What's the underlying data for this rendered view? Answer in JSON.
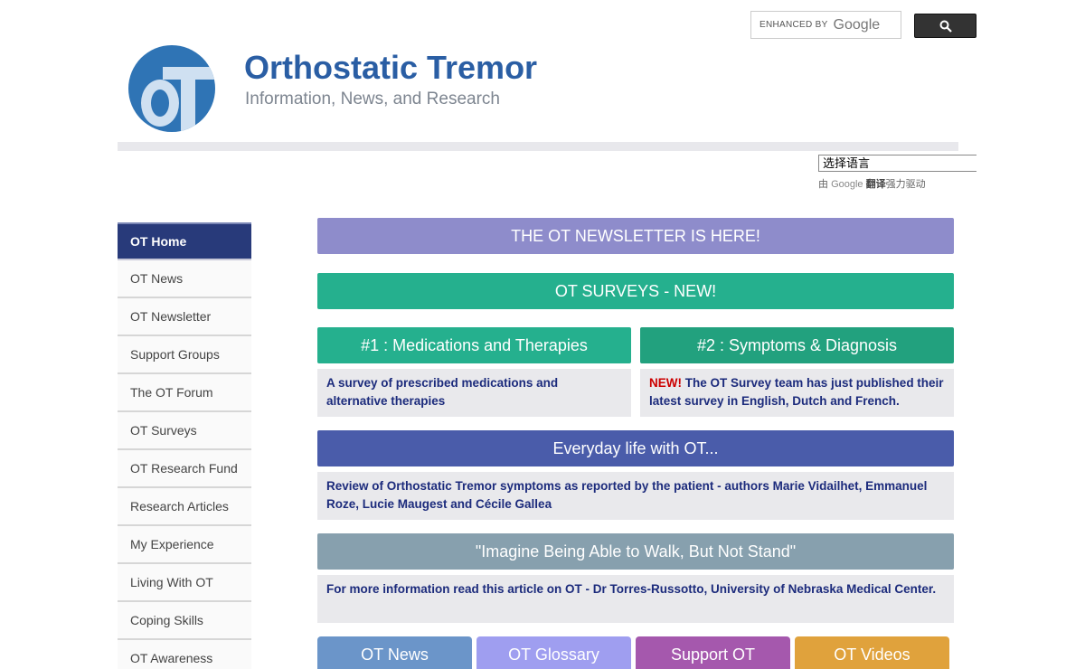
{
  "search": {
    "enhanced_label": "ENHANCED BY",
    "google_label": "Google"
  },
  "header": {
    "logo_text": "OT",
    "title": "Orthostatic Tremor",
    "subtitle": "Information, News, and Research"
  },
  "translate": {
    "select_value": "选择语言",
    "powered_prefix": "由",
    "google": "Google",
    "fanyi": "翻译",
    "powered_suffix": "强力驱动"
  },
  "sidebar": {
    "items": [
      {
        "label": "OT Home",
        "active": true
      },
      {
        "label": "OT News"
      },
      {
        "label": "OT Newsletter"
      },
      {
        "label": "Support Groups"
      },
      {
        "label": "The OT Forum"
      },
      {
        "label": "OT Surveys"
      },
      {
        "label": "OT Research Fund"
      },
      {
        "label": "Research Articles"
      },
      {
        "label": "My Experience"
      },
      {
        "label": "Living With OT"
      },
      {
        "label": "Coping Skills"
      },
      {
        "label": "OT Awareness"
      }
    ]
  },
  "main": {
    "newsletter_banner": "THE OT NEWSLETTER IS HERE!",
    "surveys_banner": "OT SURVEYS - NEW!",
    "survey1": {
      "title": "#1 : Medications and Therapies",
      "text": "A survey of prescribed medications and alternative therapies"
    },
    "survey2": {
      "title": "#2 : Symptoms & Diagnosis",
      "new_tag": "NEW!",
      "text": " The OT Survey team has just published their latest survey in English, Dutch and French."
    },
    "everyday": {
      "title": "Everyday life with OT...",
      "text": "Review of Orthostatic Tremor symptoms as reported by the patient - authors Marie Vidailhet, Emmanuel Roze, Lucie Maugest and Cécile Gallea"
    },
    "imagine": {
      "title": "\"Imagine Being Able to Walk, But Not Stand\"",
      "text": "For more information read this article on OT - Dr Torres-Russotto, University of Nebraska Medical Center."
    },
    "tabs": [
      "OT News",
      "OT Glossary",
      "Support OT",
      "OT Videos"
    ]
  },
  "colors": {
    "newsletter": "#8e8ccb",
    "surveys": "#25b08e",
    "survey1": "#25b08e",
    "survey2": "#22a17e",
    "everyday": "#4a5caa",
    "imagine": "#87a0ae",
    "tab_news": "#6b95c9",
    "tab_glossary": "#9f9ef0",
    "tab_support": "#a558ad",
    "tab_videos": "#e0a23c",
    "sidebar_active": "#283a7a"
  }
}
